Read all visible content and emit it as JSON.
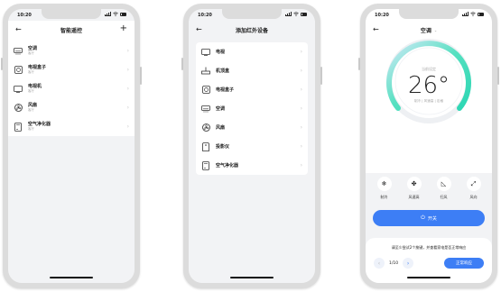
{
  "status_time": "10:20",
  "screen1": {
    "title": "智能遥控",
    "devices": [
      {
        "name": "空调",
        "sub": "客厅",
        "icon": "ac-icon"
      },
      {
        "name": "电视盒子",
        "sub": "客厅",
        "icon": "tv-box-icon"
      },
      {
        "name": "电视机",
        "sub": "客厅",
        "icon": "tv-icon"
      },
      {
        "name": "风扇",
        "sub": "客厅",
        "icon": "fan-icon"
      },
      {
        "name": "空气净化器",
        "sub": "客厅",
        "icon": "air-purifier-icon"
      }
    ]
  },
  "screen2": {
    "title": "添加红外设备",
    "devices": [
      {
        "name": "电视",
        "icon": "tv-icon"
      },
      {
        "name": "机顶盒",
        "icon": "set-top-box-icon"
      },
      {
        "name": "电视盒子",
        "icon": "tv-box-icon"
      },
      {
        "name": "空调",
        "icon": "ac-icon"
      },
      {
        "name": "风扇",
        "icon": "fan-icon"
      },
      {
        "name": "投影仪",
        "icon": "projector-icon"
      },
      {
        "name": "空气净化器",
        "icon": "air-purifier-icon"
      }
    ]
  },
  "screen3": {
    "title": "空调",
    "dial_label": "当前设定",
    "temperature": "26°",
    "dial_info": "制冷 | 风速高 | 定格",
    "modes": [
      {
        "label": "制冷",
        "icon": "snowflake-icon",
        "glyph": "❄"
      },
      {
        "label": "风速高",
        "icon": "fan-speed-icon",
        "glyph": "✤"
      },
      {
        "label": "扫风",
        "icon": "swing-icon",
        "glyph": "◺"
      },
      {
        "label": "风向",
        "icon": "wind-direction-icon",
        "glyph": "⤢"
      }
    ],
    "power_label": "开关",
    "tip_text": "请至少尝试2个按键，并查看家电是否正常响应",
    "page_indicator": "1/10",
    "ok_label": "正常响应"
  },
  "colors": {
    "accent": "#3d7ef5",
    "dial_gradient_start": "#2bd6b3",
    "dial_gradient_end": "#cfe9f7"
  }
}
